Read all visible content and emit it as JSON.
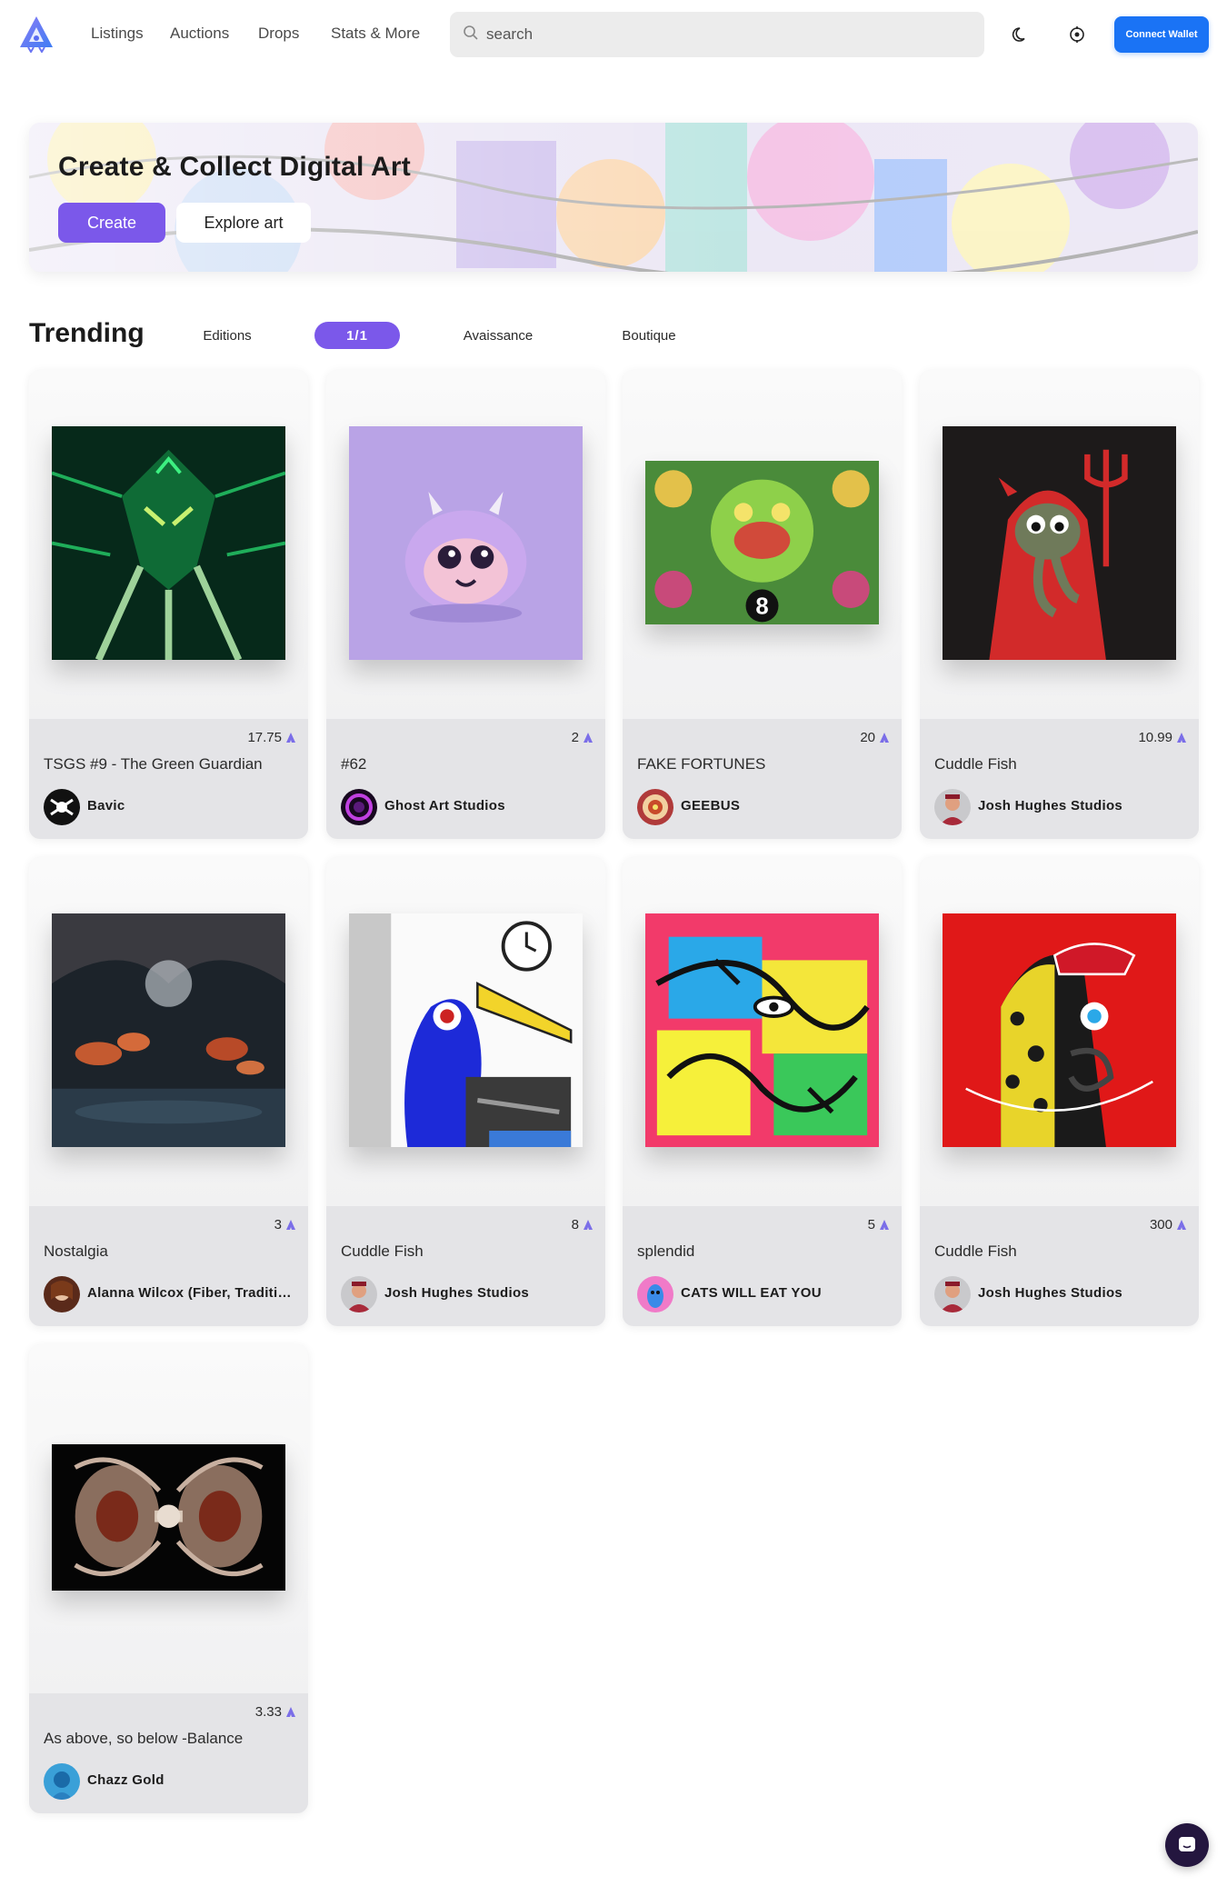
{
  "nav": {
    "links": [
      "Listings",
      "Auctions",
      "Drops",
      "Stats & More"
    ],
    "search_placeholder": "search",
    "connect_label": "Connect Wallet"
  },
  "hero": {
    "title": "Create & Collect Digital Art",
    "create_label": "Create",
    "explore_label": "Explore art"
  },
  "trending": {
    "title": "Trending",
    "tabs": [
      "Editions",
      "1/1",
      "Avaissance",
      "Boutique"
    ],
    "active_tab": "1/1"
  },
  "cards": [
    {
      "price": "17.75",
      "title": "TSGS #9 - The Green Guardian",
      "artist": "Bavic"
    },
    {
      "price": "2",
      "title": "#62",
      "artist": "Ghost Art Studios"
    },
    {
      "price": "20",
      "title": "FAKE FORTUNES",
      "artist": "GEEBUS"
    },
    {
      "price": "10.99",
      "title": "Cuddle Fish",
      "artist": "Josh Hughes Studios"
    },
    {
      "price": "3",
      "title": "Nostalgia",
      "artist": "Alanna Wilcox (Fiber, Traditional)"
    },
    {
      "price": "8",
      "title": "Cuddle Fish",
      "artist": "Josh Hughes Studios"
    },
    {
      "price": "5",
      "title": "splendid",
      "artist": "CATS WILL EAT YOU"
    },
    {
      "price": "300",
      "title": "Cuddle Fish",
      "artist": "Josh Hughes Studios"
    },
    {
      "price": "3.33",
      "title": "As above, so below -Balance",
      "artist": "Chazz Gold"
    }
  ],
  "colors": {
    "accent": "#7b58ea",
    "connect": "#1a73f5",
    "card_footer": "#e4e4e7",
    "chat": "#24163f"
  },
  "icons": [
    "logo-icon",
    "search-icon",
    "moon-icon",
    "settings-icon",
    "eth-icon",
    "chat-icon"
  ]
}
